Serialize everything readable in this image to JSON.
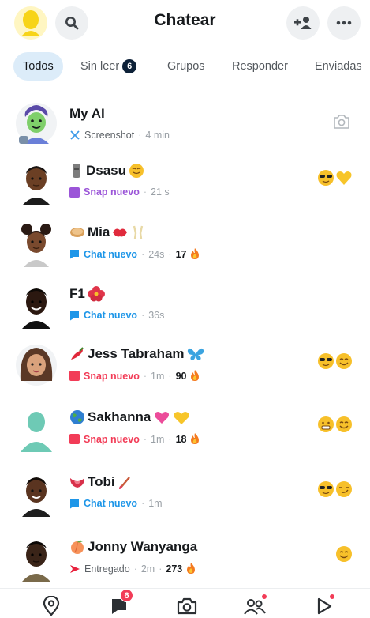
{
  "header": {
    "title": "Chatear",
    "profile_icon": "bitmoji-avatar-icon",
    "search_icon": "search-icon",
    "add_friend_icon": "add-friend-icon",
    "more_icon": "more-dots-icon"
  },
  "tabs": [
    {
      "label": "Todos",
      "active": true
    },
    {
      "label": "Sin leer",
      "badge": "6"
    },
    {
      "label": "Grupos"
    },
    {
      "label": "Responder"
    },
    {
      "label": "Enviadas"
    }
  ],
  "chats": [
    {
      "name": "My AI",
      "status": "Screenshot",
      "time": "4 min",
      "status_color": "#3c9ae8"
    },
    {
      "name": "Dsasu",
      "status": "Snap nuevo",
      "time": "21 s",
      "status_color": "#9b55d8"
    },
    {
      "name": "Mia",
      "status": "Chat nuevo",
      "time": "24s",
      "streak": "17",
      "status_color": "#1e96e8"
    },
    {
      "name": "F1",
      "status": "Chat nuevo",
      "time": "36s",
      "status_color": "#1e96e8"
    },
    {
      "name": "Jess Tabraham",
      "status": "Snap nuevo",
      "time": "1m",
      "streak": "90",
      "status_color": "#f23c57"
    },
    {
      "name": "Sakhanna",
      "status": "Snap nuevo",
      "time": "1m",
      "streak": "18",
      "status_color": "#f23c57"
    },
    {
      "name": "Tobi",
      "status": "Chat nuevo",
      "time": "1m",
      "status_color": "#1e96e8"
    },
    {
      "name": "Jonny Wanyanga",
      "status": "Entregado",
      "time": "2m",
      "streak": "273",
      "status_color": "#e8213d"
    }
  ],
  "bottom_nav": {
    "map_icon": "map-pin-icon",
    "chat_icon": "chat-icon",
    "chat_badge": "6",
    "camera_icon": "camera-icon",
    "stories_icon": "friends-icon",
    "spotlight_icon": "spotlight-play-icon"
  },
  "colors": {
    "accent": "#0d2138",
    "tab_active_bg": "#dcecf9",
    "snap_purple": "#9b55d8",
    "chat_blue": "#1e96e8",
    "snap_red": "#f23c57"
  }
}
